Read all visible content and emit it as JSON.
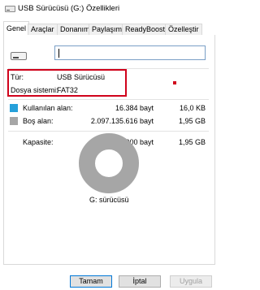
{
  "window": {
    "title": "USB Sürücüsü (G:) Özellikleri",
    "icon": "usb-drive-icon"
  },
  "tabs": [
    {
      "label": "Genel",
      "active": true
    },
    {
      "label": "Araçlar",
      "active": false
    },
    {
      "label": "Donanım",
      "active": false
    },
    {
      "label": "Paylaşım",
      "active": false
    },
    {
      "label": "ReadyBoost",
      "active": false
    },
    {
      "label": "Özelleştir",
      "active": false
    }
  ],
  "general": {
    "drive_icon": "usb-drive-icon",
    "name_value": "",
    "type_label": "Tür:",
    "type_value": "USB Sürücüsü",
    "fs_label": "Dosya sistemi:",
    "fs_value": "FAT32",
    "used_label": "Kullanılan alan:",
    "used_bytes": "16.384 bayt",
    "used_size": "16,0 KB",
    "free_label": "Boş alan:",
    "free_bytes": "2.097.135.616 bayt",
    "free_size": "1,95 GB",
    "capacity_label": "Kapasite:",
    "capacity_bytes": "2.097.152.000 bayt",
    "capacity_size": "1,95 GB",
    "drive_label": "G: sürücüsü"
  },
  "colors": {
    "used": "#26a0da",
    "free": "#a6a6a6",
    "highlight": "#d0021b"
  },
  "chart_data": {
    "type": "pie",
    "categories": [
      "Kullanılan alan",
      "Boş alan"
    ],
    "values": [
      16384,
      2097135616
    ]
  },
  "buttons": {
    "ok": "Tamam",
    "cancel": "İptal",
    "apply": "Uygula"
  }
}
